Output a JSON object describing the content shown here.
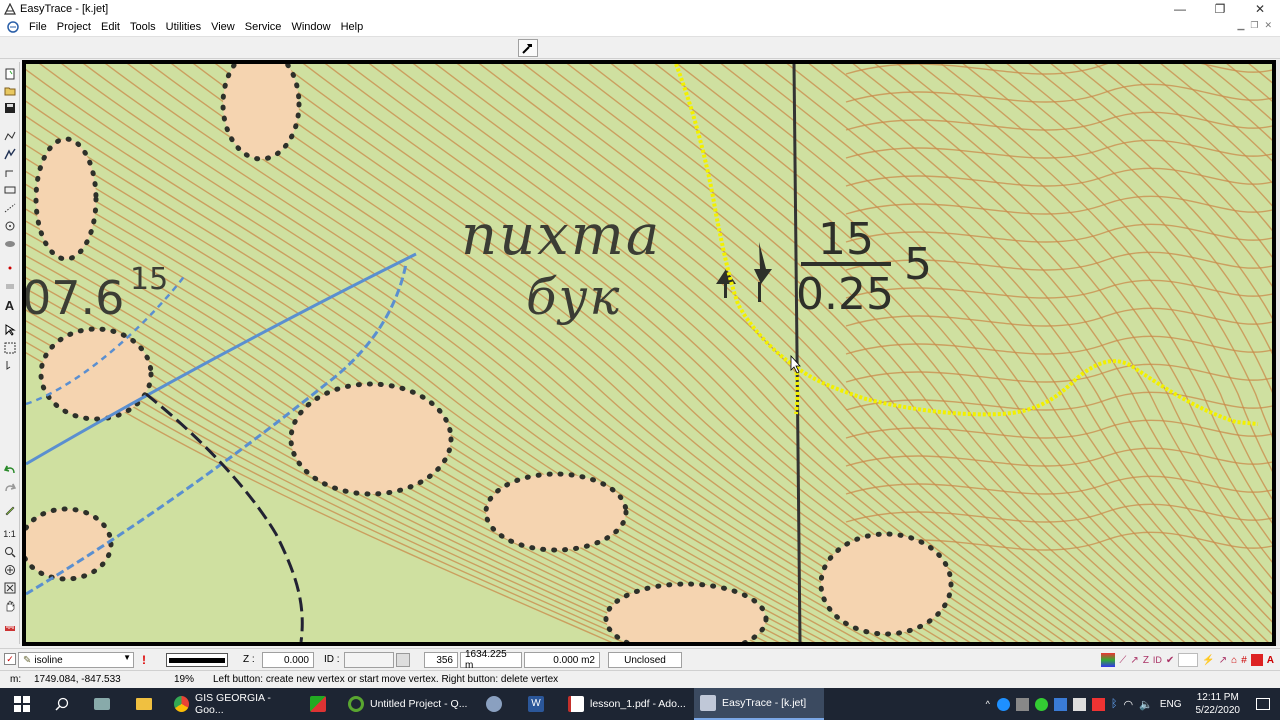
{
  "window": {
    "title": "EasyTrace - [k.jet]",
    "minimize": "—",
    "restore": "❐",
    "close": "✕"
  },
  "menu": [
    "File",
    "Project",
    "Edit",
    "Tools",
    "Utilities",
    "View",
    "Service",
    "Window",
    "Help"
  ],
  "map": {
    "labels": {
      "species_top": "пихта",
      "species_bottom": "бук",
      "elevation": "07.6",
      "elevation_suffix": "15",
      "numerator": "15",
      "denominator": "0.25",
      "side_number": "5"
    },
    "colors": {
      "background": "#cfe0a0",
      "contour": "#c98a4a",
      "clearing": "#f5d4b0",
      "river": "#5a8fd0",
      "trace": "#f2f000",
      "grid_line": "#333333"
    }
  },
  "status1": {
    "layer": "isoline",
    "z_label": "Z :",
    "z_value": "0.000",
    "id_label": "ID :",
    "id_value": "",
    "count": "356",
    "length": "1634.225 m",
    "area": "0.000 m2",
    "state": "Unclosed"
  },
  "status2": {
    "coord_label": "m:",
    "coords": "1749.084, -847.533",
    "zoom": "19%",
    "hint": "Left button: create new vertex or start move vertex. Right button: delete vertex"
  },
  "taskbar": {
    "items": [
      {
        "label": "GIS GEORGIA - Goo...",
        "color": "#e94235"
      },
      {
        "label": "",
        "color": "#d03030"
      },
      {
        "label": "Untitled Project - Q...",
        "color": "#59a630"
      },
      {
        "label": "",
        "color": "#8aa0c0"
      },
      {
        "label": "",
        "color": "#2b579a"
      },
      {
        "label": "lesson_1.pdf - Ado...",
        "color": "#c4302b"
      },
      {
        "label": "EasyTrace - [k.jet]",
        "color": "#c0c8d8"
      }
    ],
    "lang": "ENG",
    "time": "12:11 PM",
    "date": "5/22/2020"
  }
}
